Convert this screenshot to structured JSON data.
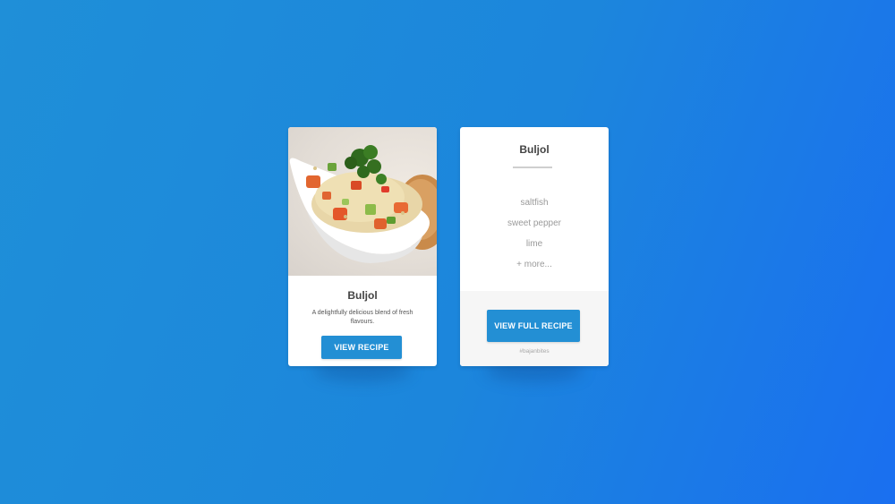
{
  "recipe_card": {
    "title": "Buljol",
    "description": "A delightfully delicious blend of fresh flavours.",
    "button_label": "VIEW RECIPE",
    "image_icon": "food-photo"
  },
  "ingredients_card": {
    "title": "Buljol",
    "ingredients": [
      "saltfish",
      "sweet pepper",
      "lime",
      "+ more..."
    ],
    "button_label": "VIEW FULL RECIPE",
    "hashtag": "#bajanbites"
  },
  "colors": {
    "background_start": "#1f8fd8",
    "background_end": "#1a6ff0",
    "button": "#238fd4",
    "card": "#ffffff"
  }
}
